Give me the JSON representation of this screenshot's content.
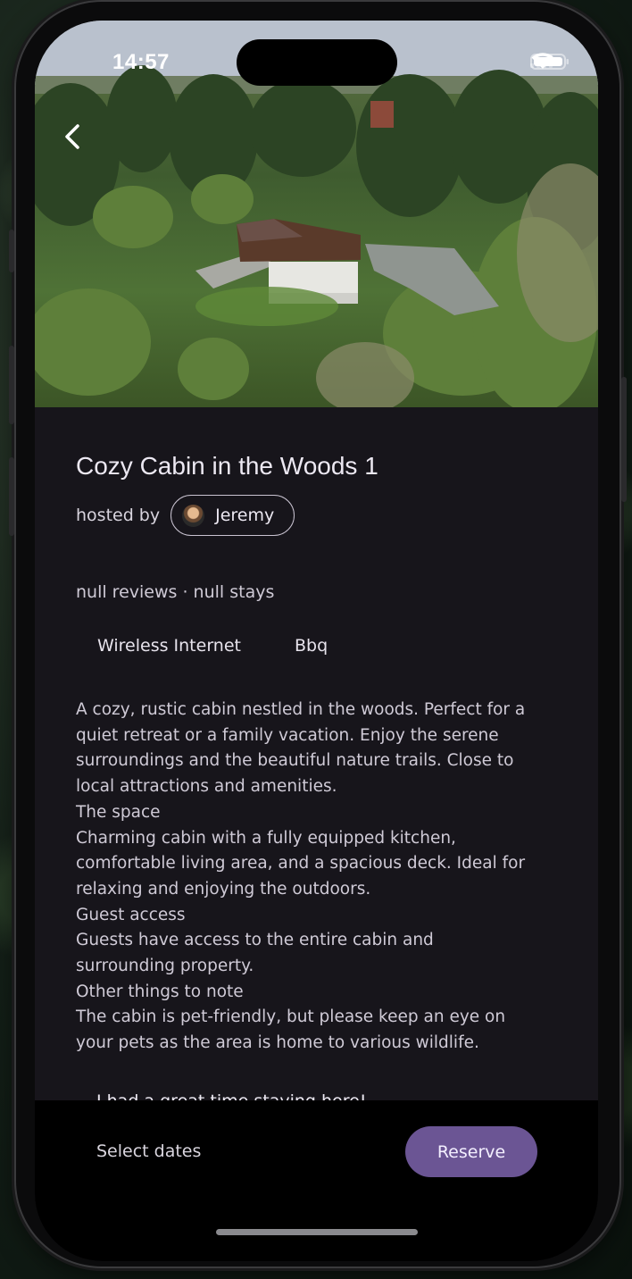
{
  "status_bar": {
    "time": "14:57"
  },
  "listing": {
    "title": "Cozy Cabin in the Woods 1",
    "hosted_by_label": "hosted by",
    "host_name": "Jeremy",
    "stats": "null reviews · null stays",
    "amenities": [
      "Wireless Internet",
      "Bbq"
    ],
    "description_lines": [
      "A cozy, rustic cabin nestled in the woods. Perfect for a",
      "quiet retreat or a family vacation. Enjoy the serene",
      "surroundings and the beautiful nature trails. Close to",
      "local attractions and amenities.",
      "The space",
      "Charming cabin with a fully equipped kitchen,",
      "comfortable living area, and a spacious deck. Ideal for",
      "relaxing and enjoying the outdoors.",
      "Guest access",
      "Guests have access to the entire cabin and",
      "surrounding property.",
      "Other things to note",
      "The cabin is pet-friendly, but please keep an eye on",
      "your pets as the area is home to various wildlife."
    ],
    "review": {
      "text": "I had a great time staying here!",
      "id_partial": "bcb0d85cb56c1be994c98579058619e78d918aaa"
    }
  },
  "bottom_bar": {
    "select_dates_label": "Select dates",
    "reserve_label": "Reserve",
    "reserve_color": "#6b5594"
  },
  "icons": {
    "back": "chevron-left-icon",
    "wifi": "wifi-icon",
    "battery": "battery-icon",
    "signal": "signal-icon"
  }
}
